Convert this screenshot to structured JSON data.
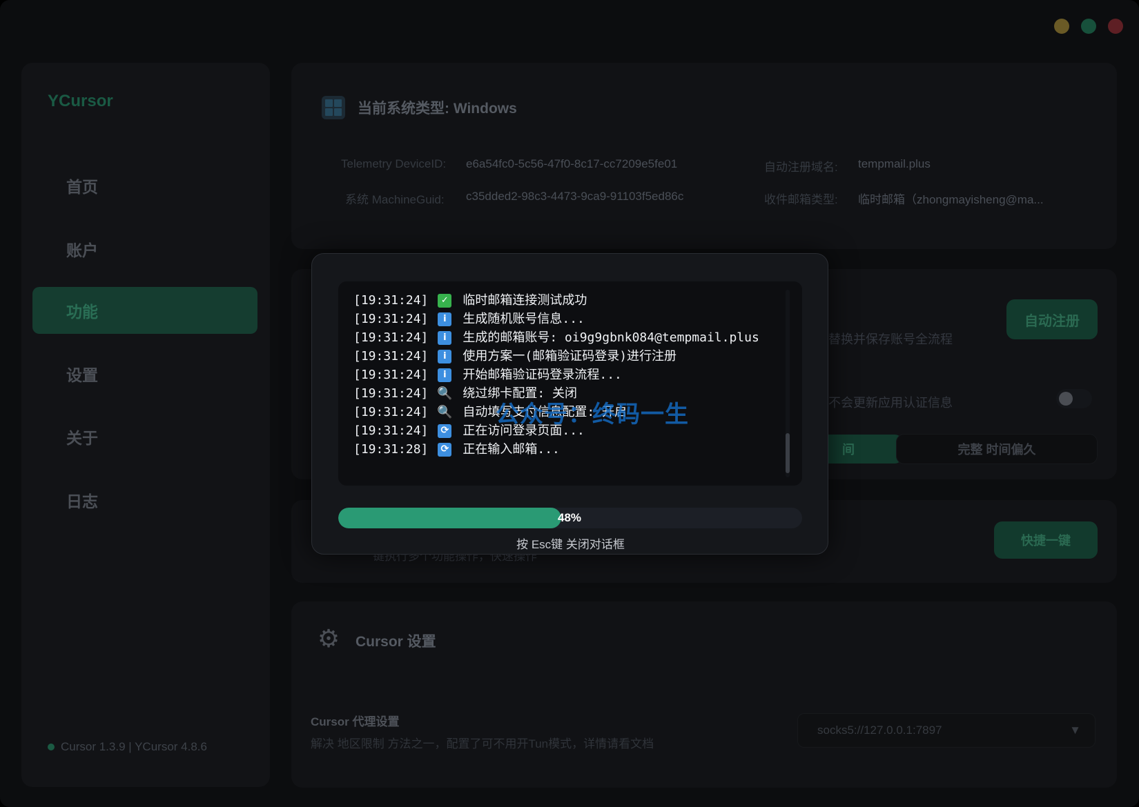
{
  "window": {
    "controls": [
      "minimize",
      "maximize",
      "close"
    ]
  },
  "sidebar": {
    "brand": "YCursor",
    "items": [
      {
        "label": "首页",
        "active": false
      },
      {
        "label": "账户",
        "active": false
      },
      {
        "label": "功能",
        "active": true
      },
      {
        "label": "设置",
        "active": false
      },
      {
        "label": "关于",
        "active": false
      },
      {
        "label": "日志",
        "active": false
      }
    ],
    "version": "Cursor 1.3.9 | YCursor 4.8.6"
  },
  "system_card": {
    "title": "当前系统类型: Windows",
    "telemetry_label": "Telemetry DeviceID:",
    "telemetry_value": "e6a54fc0-5c56-47f0-8c17-cc7209e5fe01",
    "machine_label": "系统 MachineGuid:",
    "machine_value": "c35dded2-98c3-4473-9ca9-91103f5ed86c",
    "domain_label": "自动注册域名:",
    "domain_value": "tempmail.plus",
    "mail_type_label": "收件邮箱类型:",
    "mail_type_value": "临时邮箱（zhongmayisheng@ma..."
  },
  "function_card": {
    "auto_register_button": "自动注册",
    "auto_register_desc": "替换并保存账号全流程",
    "update_auth_desc": "不会更新应用认证信息",
    "left_button_fragment": "间",
    "right_button": "完整 时间偏久"
  },
  "quick_card": {
    "button": "快捷一键",
    "desc": "键执行多个功能操作，快速操作"
  },
  "cursor_settings": {
    "title": "Cursor 设置",
    "proxy_title": "Cursor 代理设置",
    "proxy_desc": "解决 地区限制 方法之一，配置了可不用开Tun模式，详情请看文档",
    "proxy_value": "socks5://127.0.0.1:7897",
    "dropdown_arrow": "▼"
  },
  "dialog": {
    "logs": [
      {
        "time": "[19:31:24]",
        "icon": "check-icon",
        "text": "临时邮箱连接测试成功"
      },
      {
        "time": "[19:31:24]",
        "icon": "info-icon",
        "text": "生成随机账号信息..."
      },
      {
        "time": "[19:31:24]",
        "icon": "info-icon",
        "text": "生成的邮箱账号: oi9g9gbnk084@tempmail.plus"
      },
      {
        "time": "[19:31:24]",
        "icon": "info-icon",
        "text": "使用方案一(邮箱验证码登录)进行注册"
      },
      {
        "time": "[19:31:24]",
        "icon": "info-icon",
        "text": "开始邮箱验证码登录流程..."
      },
      {
        "time": "[19:31:24]",
        "icon": "search-icon",
        "text": "绕过绑卡配置: 关闭"
      },
      {
        "time": "[19:31:24]",
        "icon": "search-icon",
        "text": "自动填写支付信息配置: 开启"
      },
      {
        "time": "[19:31:24]",
        "icon": "sync-icon",
        "text": "正在访问登录页面..."
      },
      {
        "time": "[19:31:28]",
        "icon": "sync-icon",
        "text": "正在输入邮箱..."
      }
    ],
    "progress_percent": 48,
    "progress_label": "48%",
    "esc_hint": "按 Esc键 关闭对话框",
    "watermark": "公众号：终码一生"
  }
}
